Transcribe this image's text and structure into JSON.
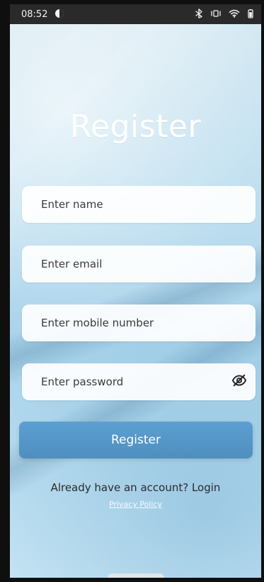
{
  "status_bar": {
    "time": "08:52",
    "left_icon": "circle-half-icon",
    "right_icons": [
      "bluetooth-icon",
      "vibrate-icon",
      "wifi-icon",
      "battery-icon"
    ]
  },
  "screen": {
    "title": "Register",
    "fields": {
      "name": {
        "placeholder": "Enter name",
        "value": ""
      },
      "email": {
        "placeholder": "Enter email",
        "value": ""
      },
      "mobile": {
        "placeholder": "Enter mobile number",
        "value": ""
      },
      "password": {
        "placeholder": "Enter password",
        "value": ""
      }
    },
    "register_button": "Register",
    "login_prompt": "Already have an account? Login",
    "privacy_link": "Privacy Policy"
  },
  "colors": {
    "primary_button": "#5c9fd2",
    "field_bg": "#ffffff",
    "title": "#ffffff"
  }
}
